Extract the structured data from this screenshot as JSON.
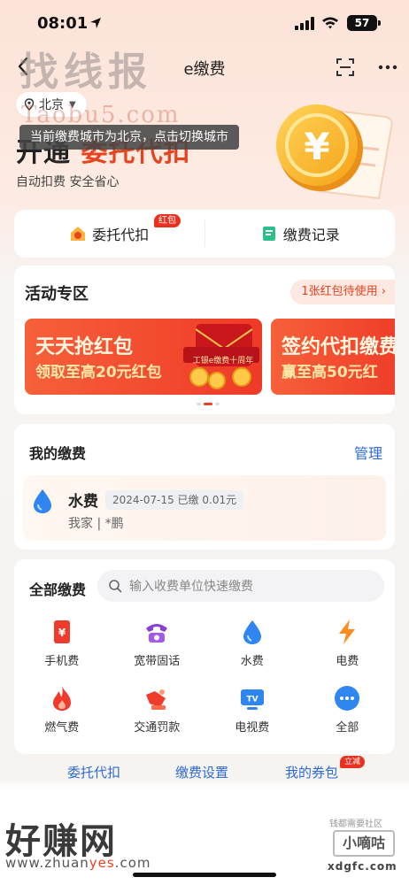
{
  "status_bar": {
    "time": "08:01",
    "battery": "57"
  },
  "nav": {
    "title": "e缴费"
  },
  "watermarks": {
    "top_text": "找线报",
    "taobao_text": "Taobu5.com",
    "bottom_text": "好赚网",
    "bottom_url_a": "www.zhuan",
    "bottom_url_b": "yes",
    "bottom_url_c": ".com",
    "right_small": "钱都需要社区",
    "right_box": "小嘀咕",
    "right_url": "xdgfc.com"
  },
  "hero": {
    "city": "北京",
    "title_prefix": "开通",
    "title_accent": "委托代扣",
    "tooltip": "当前缴费城市为北京，点击切换城市",
    "subtitle": "自动扣费 安全省心"
  },
  "quick": {
    "items": [
      {
        "label": "委托代扣",
        "badge": "红包",
        "icon": "house-coin-icon"
      },
      {
        "label": "缴费记录",
        "icon": "record-icon"
      }
    ]
  },
  "activity": {
    "title": "活动专区",
    "pill": "1张红包待使用 ›",
    "banners": [
      {
        "line1": "天天抢红包",
        "line2": "领取至高20元红包",
        "art_label": "工银e缴费十周年"
      },
      {
        "line1": "签约代扣缴费",
        "line2": "赢至高50元红"
      }
    ]
  },
  "my_payments": {
    "title": "我的缴费",
    "manage": "管理",
    "bills": [
      {
        "name": "水费",
        "tag": "2024-07-15 已缴 0.01元",
        "account": "我家 | *鹏",
        "icon": "water-drop-icon"
      }
    ]
  },
  "all_payments": {
    "title": "全部缴费",
    "search_placeholder": "输入收费单位快速缴费",
    "items": [
      {
        "label": "手机费",
        "icon": "phone-bill-icon"
      },
      {
        "label": "宽带固话",
        "icon": "telephone-icon"
      },
      {
        "label": "水费",
        "icon": "water-drop-icon"
      },
      {
        "label": "电费",
        "icon": "lightning-icon"
      },
      {
        "label": "燃气费",
        "icon": "flame-icon"
      },
      {
        "label": "交通罚款",
        "icon": "traffic-horn-icon"
      },
      {
        "label": "电视费",
        "icon": "tv-icon"
      },
      {
        "label": "全部",
        "icon": "more-dots-icon"
      }
    ]
  },
  "footer": {
    "links": [
      "委托代扣",
      "缴费设置",
      "我的券包"
    ],
    "badge": "立减"
  },
  "colors": {
    "accent": "#e8431f",
    "link": "#2d6bd5"
  }
}
